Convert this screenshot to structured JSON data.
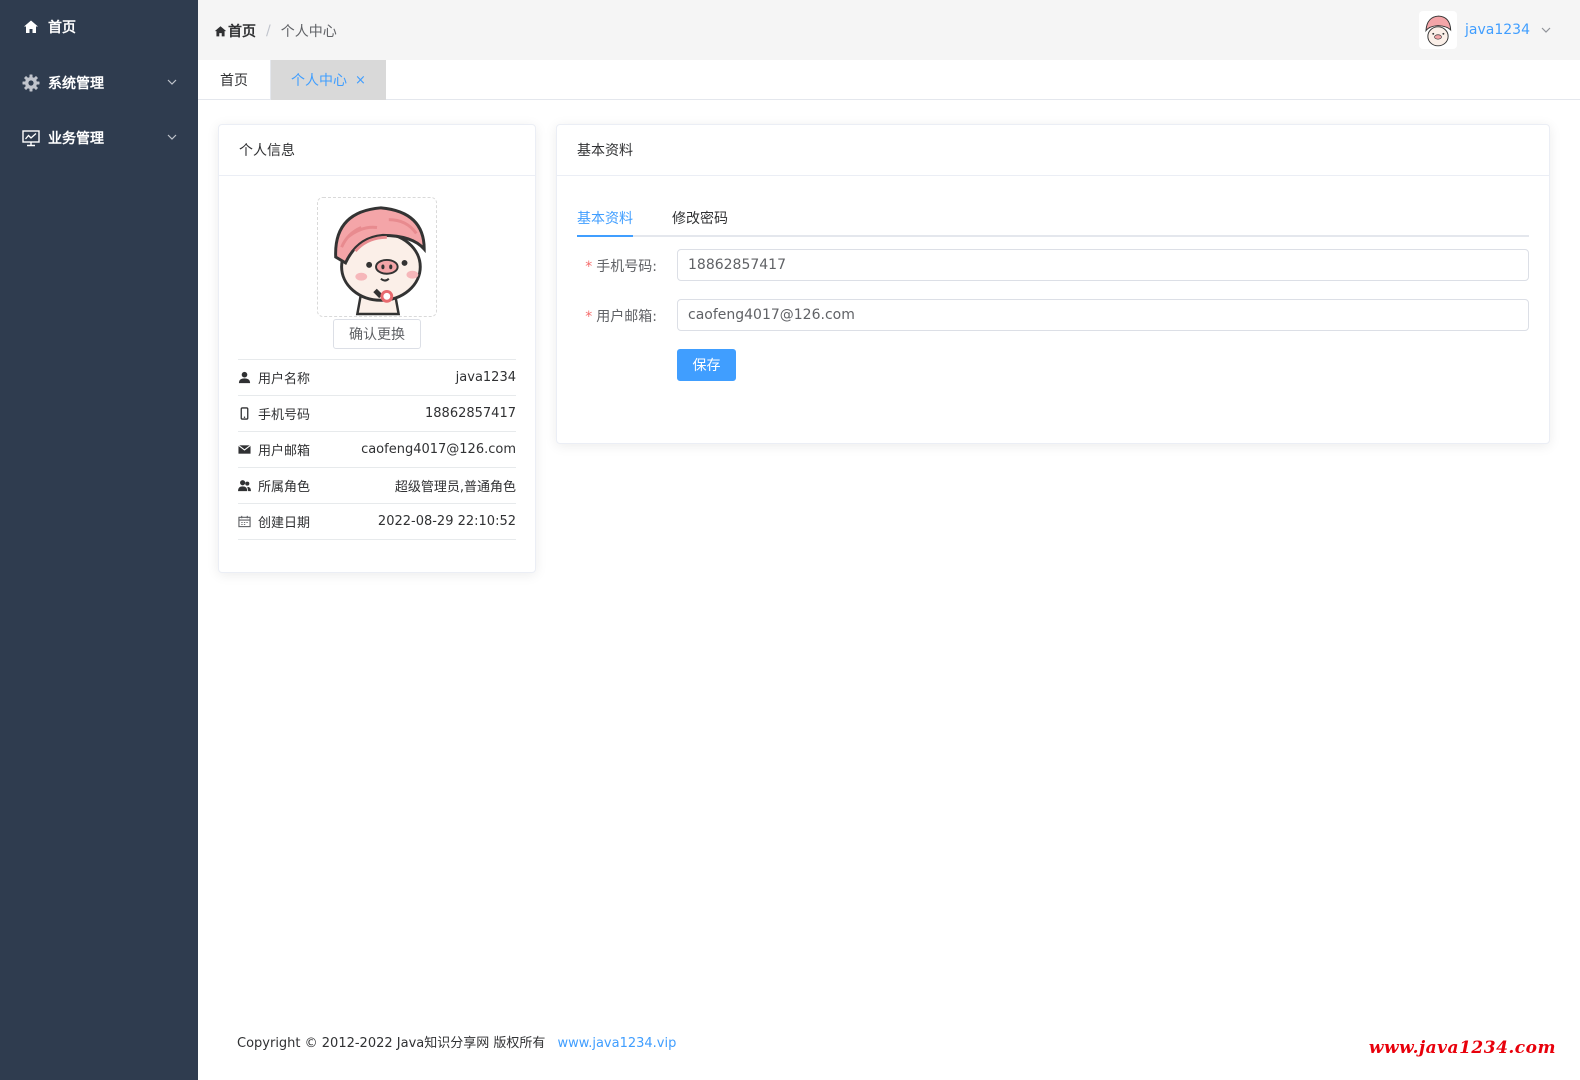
{
  "sidebar": {
    "items": [
      {
        "label": "首页",
        "icon": "home-icon"
      },
      {
        "label": "系统管理",
        "icon": "gear-icon"
      },
      {
        "label": "业务管理",
        "icon": "monitor-chart-icon"
      }
    ]
  },
  "header": {
    "breadcrumb": {
      "home": "首页",
      "separator": "/",
      "current": "个人中心"
    },
    "user": {
      "name": "java1234"
    }
  },
  "tabs": [
    {
      "label": "首页"
    },
    {
      "label": "个人中心",
      "close": "×"
    }
  ],
  "profile_card": {
    "title": "个人信息",
    "confirm_button": "确认更换",
    "rows": [
      {
        "icon": "user-icon",
        "label": "用户名称",
        "value": "java1234"
      },
      {
        "icon": "phone-icon",
        "label": "手机号码",
        "value": "18862857417"
      },
      {
        "icon": "mail-icon",
        "label": "用户邮箱",
        "value": "caofeng4017@126.com"
      },
      {
        "icon": "users-icon",
        "label": "所属角色",
        "value": "超级管理员,普通角色"
      },
      {
        "icon": "calendar-icon",
        "label": "创建日期",
        "value": "2022-08-29 22:10:52"
      }
    ]
  },
  "basic_card": {
    "title": "基本资料",
    "tabs": [
      {
        "label": "基本资料"
      },
      {
        "label": "修改密码"
      }
    ],
    "fields": {
      "phone": {
        "label": "手机号码:",
        "value": "18862857417"
      },
      "email": {
        "label": "用户邮箱:",
        "value": "caofeng4017@126.com"
      }
    },
    "save_button": "保存"
  },
  "footer": {
    "copyright": "Copyright © 2012-2022 Java知识分享网 版权所有",
    "link": "www.java1234.vip"
  },
  "watermark": "www.java1234.com",
  "colors": {
    "sidebar": "#2f3c4f",
    "accent": "#409eff",
    "required": "#f56c6c",
    "watermark": "#e8000b"
  }
}
